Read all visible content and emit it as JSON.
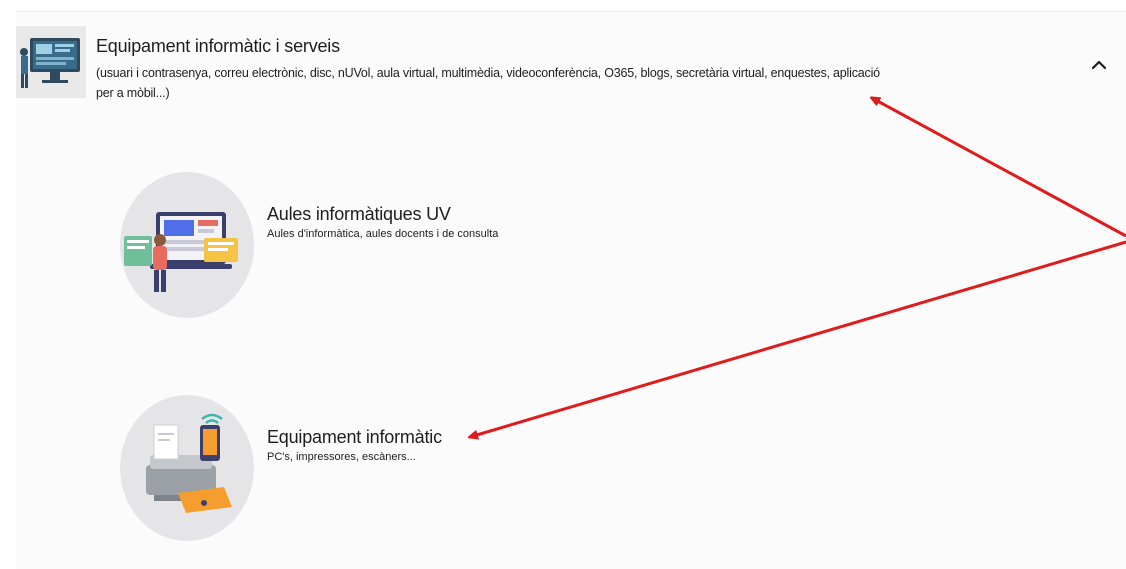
{
  "section": {
    "title": "Equipament informàtic i serveis",
    "description": "(usuari i contrasenya, correu electrònic, disc, nUVol, aula virtual, multimèdia, videoconferència, O365, blogs, secretària virtual, enquestes, aplicació per a mòbil...)",
    "collapse_icon": "chevron-up-icon",
    "thumb_icon": "computer-monitor-icon"
  },
  "items": [
    {
      "title": "Aules informàtiques UV",
      "description": "Aules d'informàtica, aules docents i de consulta",
      "icon": "computer-classroom-illustration"
    },
    {
      "title": "Equipament informàtic",
      "description": "PC's, impressores, escàners...",
      "icon": "printer-scanner-illustration"
    }
  ],
  "colors": {
    "panel_bg": "#fbfbfb",
    "circle_bg": "#e5e5e7",
    "text": "#1e1e1e",
    "arrow": "#e01b1b",
    "accent_orange": "#f59e2f"
  }
}
